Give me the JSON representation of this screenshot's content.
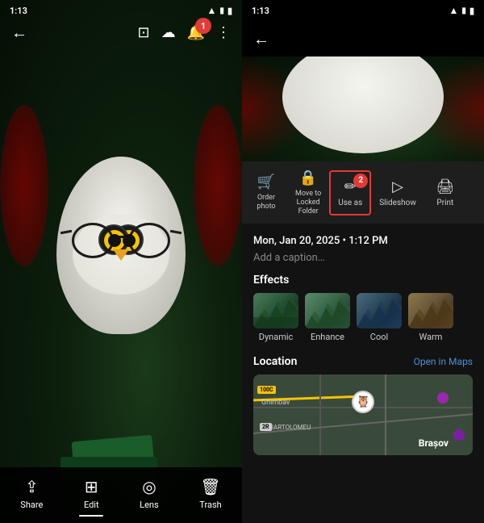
{
  "left": {
    "status_time": "1:13",
    "toolbar": {
      "badge_label": "1"
    },
    "bottom_actions": [
      {
        "id": "share",
        "label": "Share",
        "icon": "⇪"
      },
      {
        "id": "edit",
        "label": "Edit",
        "icon": "⊞",
        "active": true
      },
      {
        "id": "lens",
        "label": "Lens",
        "icon": "◎"
      },
      {
        "id": "trash",
        "label": "Trash",
        "icon": "🗑"
      }
    ]
  },
  "right": {
    "status_time": "1:13",
    "actions": [
      {
        "id": "order_photo",
        "label": "Order photo",
        "icon": "🛒"
      },
      {
        "id": "locked_folder",
        "label": "Move to Locked Folder",
        "icon": "🔒"
      },
      {
        "id": "use_as",
        "label": "Use as",
        "icon": "✏",
        "highlighted": true
      },
      {
        "id": "slideshow",
        "label": "Slideshow",
        "icon": "▷"
      },
      {
        "id": "print",
        "label": "Print",
        "icon": "🖨"
      }
    ],
    "badge_label": "2",
    "info": {
      "date": "Mon, Jan 20, 2025 • 1:12 PM",
      "caption_placeholder": "Add a caption…"
    },
    "effects": {
      "title": "Effects",
      "items": [
        {
          "id": "dynamic",
          "label": "Dynamic"
        },
        {
          "id": "enhance",
          "label": "Enhance"
        },
        {
          "id": "cool",
          "label": "Cool"
        },
        {
          "id": "warm",
          "label": "Warm"
        }
      ]
    },
    "location": {
      "title": "Location",
      "open_maps": "Open in Maps",
      "city": "Brașov",
      "ghimbav": "Ghimbav",
      "bartolomeu": "BARTOLOMEU"
    }
  }
}
